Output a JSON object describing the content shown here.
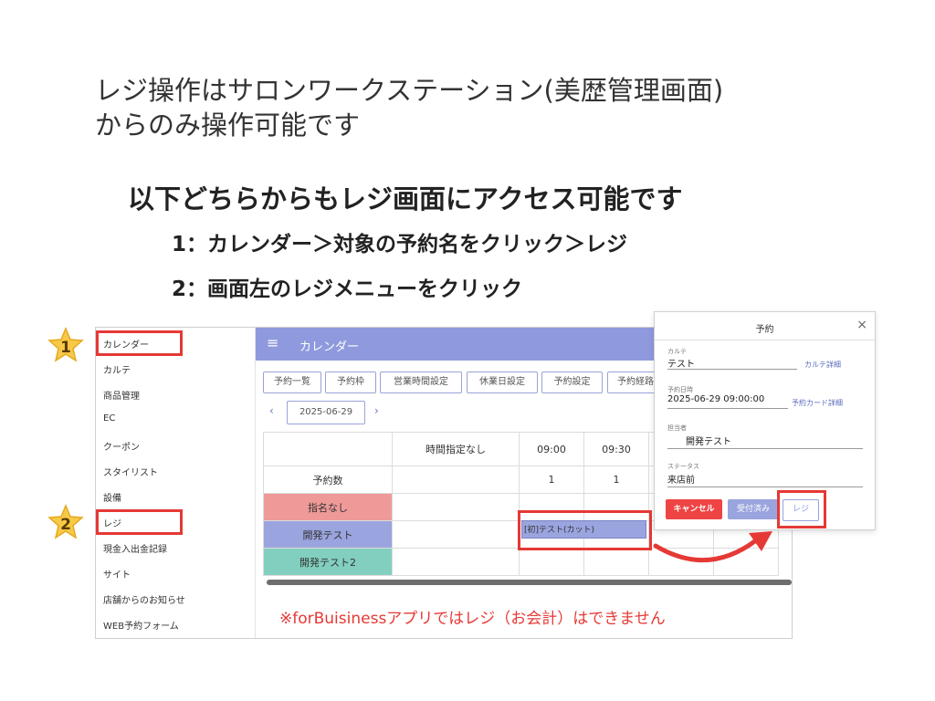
{
  "heading": {
    "line1": "レジ操作はサロンワークステーション(美歴管理画面)\nからのみ操作可能です",
    "line2": "以下どちらからもレジ画面にアクセス可能です",
    "step1": "1：カレンダー＞対象の予約名をクリック＞レジ",
    "step2": "2：画面左のレジメニューをクリック"
  },
  "badges": [
    "1",
    "2"
  ],
  "sidebar": {
    "items": [
      "カレンダー",
      "カルテ",
      "商品管理",
      "EC",
      "クーポン",
      "スタイリスト",
      "設備",
      "レジ",
      "現金入出金記録",
      "サイト",
      "店舗からのお知らせ",
      "WEB予約フォーム"
    ]
  },
  "topbar": {
    "menu_icon": "≡",
    "title": "カレンダー"
  },
  "tabs": [
    "予約一覧",
    "予約枠",
    "営業時間設定",
    "休業日設定",
    "予約設定",
    "予約経路"
  ],
  "datebar": {
    "prev": "‹",
    "date": "2025-06-29",
    "next": "›"
  },
  "calendar": {
    "headers": [
      "",
      "時間指定なし",
      "09:00",
      "09:30"
    ],
    "count_label": "予約数",
    "counts": [
      "",
      "1",
      "1"
    ],
    "staff": [
      "指名なし",
      "開発テスト",
      "開発テスト2"
    ],
    "appointment": "[初]テスト(カット)"
  },
  "note": "※forBuisinessアプリではレジ（お会計）はできません",
  "popup": {
    "title": "予約",
    "close": "×",
    "karte_label": "カルテ",
    "karte_value": "テスト",
    "karte_link": "カルテ詳細",
    "datetime_label": "予約日時",
    "datetime_value": "2025-06-29 09:00:00",
    "card_link": "予約カード詳細",
    "staff_label": "担当者",
    "staff_value": "開発テスト",
    "status_label": "ステータス",
    "status_value": "来店前",
    "btn_cancel": "キャンセル",
    "btn_received": "受付済み",
    "btn_register": "レジ"
  },
  "colors": {
    "accent": "#8f99dd",
    "highlight": "#e53935",
    "staff_none": "#ef9999",
    "staff_dev": "#9aa4de",
    "staff_dev2": "#82cfbf"
  }
}
